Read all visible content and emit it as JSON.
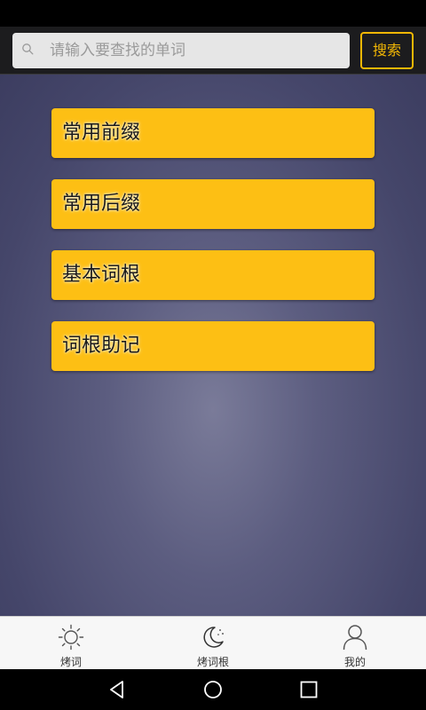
{
  "search": {
    "placeholder": "请输入要查找的单词",
    "value": "",
    "button_label": "搜索"
  },
  "menu": {
    "items": [
      {
        "label": "常用前缀"
      },
      {
        "label": "常用后缀"
      },
      {
        "label": "基本词根"
      },
      {
        "label": "词根助记"
      }
    ]
  },
  "tabs": [
    {
      "label": "烤词",
      "icon": "sun-icon",
      "active": false
    },
    {
      "label": "烤词根",
      "icon": "moon-icon",
      "active": true
    },
    {
      "label": "我的",
      "icon": "person-icon",
      "active": false
    }
  ],
  "nav": {
    "back_icon": "back-triangle-icon",
    "home_icon": "home-circle-icon",
    "recents_icon": "recents-square-icon"
  },
  "colors": {
    "accent": "#fdbf14",
    "search_button": "#f2b705",
    "background": "#4a4b6e"
  }
}
